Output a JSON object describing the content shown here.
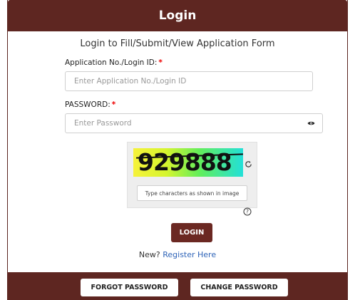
{
  "header": {
    "title": "Login"
  },
  "subtitle": "Login to Fill/Submit/View Application Form",
  "application_field": {
    "label": "Application No./Login ID:",
    "required_mark": "*",
    "placeholder": "Enter Application No./Login ID"
  },
  "password_field": {
    "label": "PASSWORD:",
    "required_mark": "*",
    "placeholder": "Enter Password"
  },
  "captcha": {
    "code": "929888",
    "input_placeholder": "Type characters as shown in image"
  },
  "login_button": "LOGIN",
  "register": {
    "prefix": "New?",
    "link": "Register Here"
  },
  "footer": {
    "forgot_password": "FORGOT PASSWORD",
    "change_password": "CHANGE PASSWORD"
  },
  "colors": {
    "brand": "#5e2621",
    "link": "#2f64b8",
    "required": "#ee0000"
  }
}
